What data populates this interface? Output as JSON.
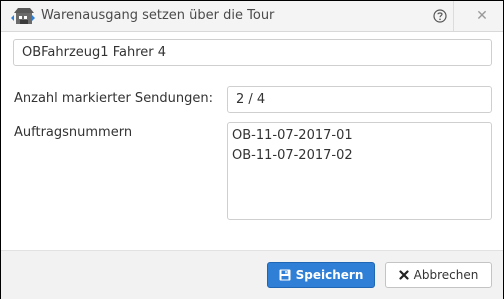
{
  "dialog": {
    "title": "Warenausgang setzen über die Tour",
    "title_icon": "forklift-warehouse-icon",
    "help_icon": "question-circle-icon",
    "close_icon": "close-icon",
    "close_glyph": "✕"
  },
  "form": {
    "vehicle_driver_value": "OBFahrzeug1 Fahrer 4",
    "marked_count_label": "Anzahl markierter Sendungen:",
    "marked_count_value": "2 / 4",
    "order_numbers_label": "Auftragsnummern",
    "order_numbers_value": "OB-11-07-2017-01\nOB-11-07-2017-02"
  },
  "footer": {
    "save_label": "Speichern",
    "save_icon": "floppy-disk-icon",
    "cancel_label": "Abbrechen",
    "cancel_icon": "x-mark-icon"
  },
  "colors": {
    "primary": "#2f7fd6",
    "titlebar_bg": "#f4f4f4",
    "footer_bg": "#f2f2f2"
  }
}
